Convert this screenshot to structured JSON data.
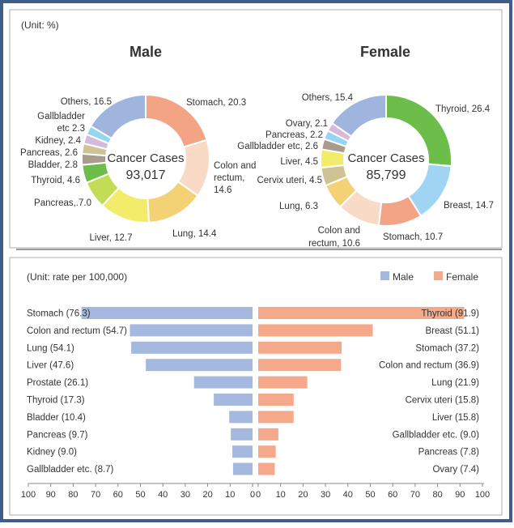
{
  "chart_data": [
    {
      "type": "pie",
      "variant": "donut",
      "unit_label": "(Unit: %)",
      "title": "Male",
      "center_label": "Cancer Cases",
      "center_value": "93,017",
      "slices": [
        {
          "label": "Stomach, 20.3",
          "name": "Stomach",
          "value": 20.3,
          "color": "#f2a485"
        },
        {
          "label": "Colon and rectum, 14.6",
          "name": "Colon and rectum",
          "value": 14.6,
          "color": "#f8dac6"
        },
        {
          "label": "Lung, 14.4",
          "name": "Lung",
          "value": 14.4,
          "color": "#f3d175"
        },
        {
          "label": "Liver, 12.7",
          "name": "Liver",
          "value": 12.7,
          "color": "#f2ec6a"
        },
        {
          "label": "Pancreas,.7.0",
          "name": "Pancreas",
          "value": 7.0,
          "color": "#c3dc55"
        },
        {
          "label": "Thyroid, 4.6",
          "name": "Thyroid",
          "value": 4.6,
          "color": "#6cbd4a"
        },
        {
          "label": "Bladder, 2.8",
          "name": "Bladder",
          "value": 2.8,
          "color": "#a99b8e"
        },
        {
          "label": "Pancreas, 2.6",
          "name": "Pancreas",
          "value": 2.6,
          "color": "#cfc394"
        },
        {
          "label": "Kidney, 2.4",
          "name": "Kidney",
          "value": 2.4,
          "color": "#d5badd"
        },
        {
          "label": "Gallbladder etc  2.3",
          "name": "Gallbladder etc",
          "value": 2.3,
          "color": "#93d5f2"
        },
        {
          "label": "Others, 16.5",
          "name": "Others",
          "value": 16.5,
          "color": "#a0b5dd"
        }
      ]
    },
    {
      "type": "pie",
      "variant": "donut",
      "title": "Female",
      "center_label": "Cancer Cases",
      "center_value": "85,799",
      "slices": [
        {
          "label": "Thyroid, 26.4",
          "name": "Thyroid",
          "value": 26.4,
          "color": "#6cbd4a"
        },
        {
          "label": "Breast, 14.7",
          "name": "Breast",
          "value": 14.7,
          "color": "#9fd5f3"
        },
        {
          "label": "Stomach, 10.7",
          "name": "Stomach",
          "value": 10.7,
          "color": "#f2a485"
        },
        {
          "label": "Colon and rectum, 10.6",
          "name": "Colon and rectum",
          "value": 10.6,
          "color": "#f8dac6"
        },
        {
          "label": "Lung, 6.3",
          "name": "Lung",
          "value": 6.3,
          "color": "#f3d175"
        },
        {
          "label": "Cervix uteri, 4.5",
          "name": "Cervix uteri",
          "value": 4.5,
          "color": "#cfc394"
        },
        {
          "label": "Liver, 4.5",
          "name": "Liver",
          "value": 4.5,
          "color": "#f2ec6a"
        },
        {
          "label": "Gallbladder etc, 2.6",
          "name": "Gallbladder etc",
          "value": 2.6,
          "color": "#a99b8e"
        },
        {
          "label": "Pancreas, 2.2",
          "name": "Pancreas",
          "value": 2.2,
          "color": "#93d5f2"
        },
        {
          "label": "Ovary, 2.1",
          "name": "Ovary",
          "value": 2.1,
          "color": "#d5badd"
        },
        {
          "label": "Others, 15.4",
          "name": "Others",
          "value": 15.4,
          "color": "#a0b5dd"
        }
      ]
    },
    {
      "type": "bar",
      "orientation": "horizontal-butterfly",
      "unit_label": "(Unit: rate per 100,000)",
      "legend": {
        "placement": "top-right",
        "entries": [
          "Male",
          "Female"
        ]
      },
      "xlim": [
        0,
        100
      ],
      "xticks_left": [
        "100",
        "90",
        "80",
        "70",
        "60",
        "50",
        "40",
        "30",
        "20",
        "10",
        "0"
      ],
      "xticks_right": [
        "0",
        "10",
        "20",
        "30",
        "40",
        "50",
        "60",
        "70",
        "80",
        "90",
        "100"
      ],
      "series": [
        {
          "name": "Male",
          "color": "#a4b8e0",
          "categories": [
            "Stomach (76.3)",
            "Colon and rectum (54.7)",
            "Lung (54.1)",
            "Liver (47.6)",
            "Prostate (26.1)",
            "Thyroid (17.3)",
            "Bladder (10.4)",
            "Pancreas (9.7)",
            "Kidney (9.0)",
            "Gallbladder etc. (8.7)"
          ],
          "values": [
            76.3,
            54.7,
            54.1,
            47.6,
            26.1,
            17.3,
            10.4,
            9.7,
            9.0,
            8.7
          ]
        },
        {
          "name": "Female",
          "color": "#f4a98b",
          "categories": [
            "Thyroid (91.9)",
            "Breast (51.1)",
            "Stomach (37.2)",
            "Colon and rectum (36.9)",
            "Lung (21.9)",
            "Cervix uteri (15.8)",
            "Liver (15.8)",
            "Gallbladder etc. (9.0)",
            "Pancreas (7.8)",
            "Ovary (7.4)"
          ],
          "values": [
            91.9,
            51.1,
            37.2,
            36.9,
            21.9,
            15.8,
            15.8,
            9.0,
            7.8,
            7.4
          ]
        }
      ]
    }
  ]
}
